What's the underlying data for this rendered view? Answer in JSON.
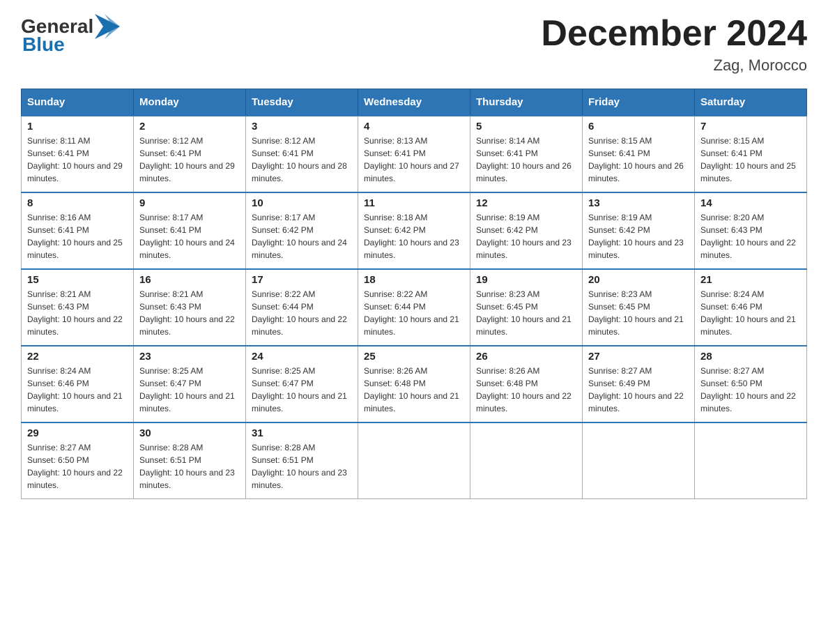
{
  "header": {
    "logo": {
      "general": "General",
      "blue": "Blue",
      "arrow_color": "#1a6faf"
    },
    "title": "December 2024",
    "location": "Zag, Morocco"
  },
  "calendar": {
    "days_of_week": [
      "Sunday",
      "Monday",
      "Tuesday",
      "Wednesday",
      "Thursday",
      "Friday",
      "Saturday"
    ],
    "weeks": [
      [
        {
          "day": "1",
          "sunrise": "8:11 AM",
          "sunset": "6:41 PM",
          "daylight": "10 hours and 29 minutes."
        },
        {
          "day": "2",
          "sunrise": "8:12 AM",
          "sunset": "6:41 PM",
          "daylight": "10 hours and 29 minutes."
        },
        {
          "day": "3",
          "sunrise": "8:12 AM",
          "sunset": "6:41 PM",
          "daylight": "10 hours and 28 minutes."
        },
        {
          "day": "4",
          "sunrise": "8:13 AM",
          "sunset": "6:41 PM",
          "daylight": "10 hours and 27 minutes."
        },
        {
          "day": "5",
          "sunrise": "8:14 AM",
          "sunset": "6:41 PM",
          "daylight": "10 hours and 26 minutes."
        },
        {
          "day": "6",
          "sunrise": "8:15 AM",
          "sunset": "6:41 PM",
          "daylight": "10 hours and 26 minutes."
        },
        {
          "day": "7",
          "sunrise": "8:15 AM",
          "sunset": "6:41 PM",
          "daylight": "10 hours and 25 minutes."
        }
      ],
      [
        {
          "day": "8",
          "sunrise": "8:16 AM",
          "sunset": "6:41 PM",
          "daylight": "10 hours and 25 minutes."
        },
        {
          "day": "9",
          "sunrise": "8:17 AM",
          "sunset": "6:41 PM",
          "daylight": "10 hours and 24 minutes."
        },
        {
          "day": "10",
          "sunrise": "8:17 AM",
          "sunset": "6:42 PM",
          "daylight": "10 hours and 24 minutes."
        },
        {
          "day": "11",
          "sunrise": "8:18 AM",
          "sunset": "6:42 PM",
          "daylight": "10 hours and 23 minutes."
        },
        {
          "day": "12",
          "sunrise": "8:19 AM",
          "sunset": "6:42 PM",
          "daylight": "10 hours and 23 minutes."
        },
        {
          "day": "13",
          "sunrise": "8:19 AM",
          "sunset": "6:42 PM",
          "daylight": "10 hours and 23 minutes."
        },
        {
          "day": "14",
          "sunrise": "8:20 AM",
          "sunset": "6:43 PM",
          "daylight": "10 hours and 22 minutes."
        }
      ],
      [
        {
          "day": "15",
          "sunrise": "8:21 AM",
          "sunset": "6:43 PM",
          "daylight": "10 hours and 22 minutes."
        },
        {
          "day": "16",
          "sunrise": "8:21 AM",
          "sunset": "6:43 PM",
          "daylight": "10 hours and 22 minutes."
        },
        {
          "day": "17",
          "sunrise": "8:22 AM",
          "sunset": "6:44 PM",
          "daylight": "10 hours and 22 minutes."
        },
        {
          "day": "18",
          "sunrise": "8:22 AM",
          "sunset": "6:44 PM",
          "daylight": "10 hours and 21 minutes."
        },
        {
          "day": "19",
          "sunrise": "8:23 AM",
          "sunset": "6:45 PM",
          "daylight": "10 hours and 21 minutes."
        },
        {
          "day": "20",
          "sunrise": "8:23 AM",
          "sunset": "6:45 PM",
          "daylight": "10 hours and 21 minutes."
        },
        {
          "day": "21",
          "sunrise": "8:24 AM",
          "sunset": "6:46 PM",
          "daylight": "10 hours and 21 minutes."
        }
      ],
      [
        {
          "day": "22",
          "sunrise": "8:24 AM",
          "sunset": "6:46 PM",
          "daylight": "10 hours and 21 minutes."
        },
        {
          "day": "23",
          "sunrise": "8:25 AM",
          "sunset": "6:47 PM",
          "daylight": "10 hours and 21 minutes."
        },
        {
          "day": "24",
          "sunrise": "8:25 AM",
          "sunset": "6:47 PM",
          "daylight": "10 hours and 21 minutes."
        },
        {
          "day": "25",
          "sunrise": "8:26 AM",
          "sunset": "6:48 PM",
          "daylight": "10 hours and 21 minutes."
        },
        {
          "day": "26",
          "sunrise": "8:26 AM",
          "sunset": "6:48 PM",
          "daylight": "10 hours and 22 minutes."
        },
        {
          "day": "27",
          "sunrise": "8:27 AM",
          "sunset": "6:49 PM",
          "daylight": "10 hours and 22 minutes."
        },
        {
          "day": "28",
          "sunrise": "8:27 AM",
          "sunset": "6:50 PM",
          "daylight": "10 hours and 22 minutes."
        }
      ],
      [
        {
          "day": "29",
          "sunrise": "8:27 AM",
          "sunset": "6:50 PM",
          "daylight": "10 hours and 22 minutes."
        },
        {
          "day": "30",
          "sunrise": "8:28 AM",
          "sunset": "6:51 PM",
          "daylight": "10 hours and 23 minutes."
        },
        {
          "day": "31",
          "sunrise": "8:28 AM",
          "sunset": "6:51 PM",
          "daylight": "10 hours and 23 minutes."
        },
        null,
        null,
        null,
        null
      ]
    ]
  }
}
